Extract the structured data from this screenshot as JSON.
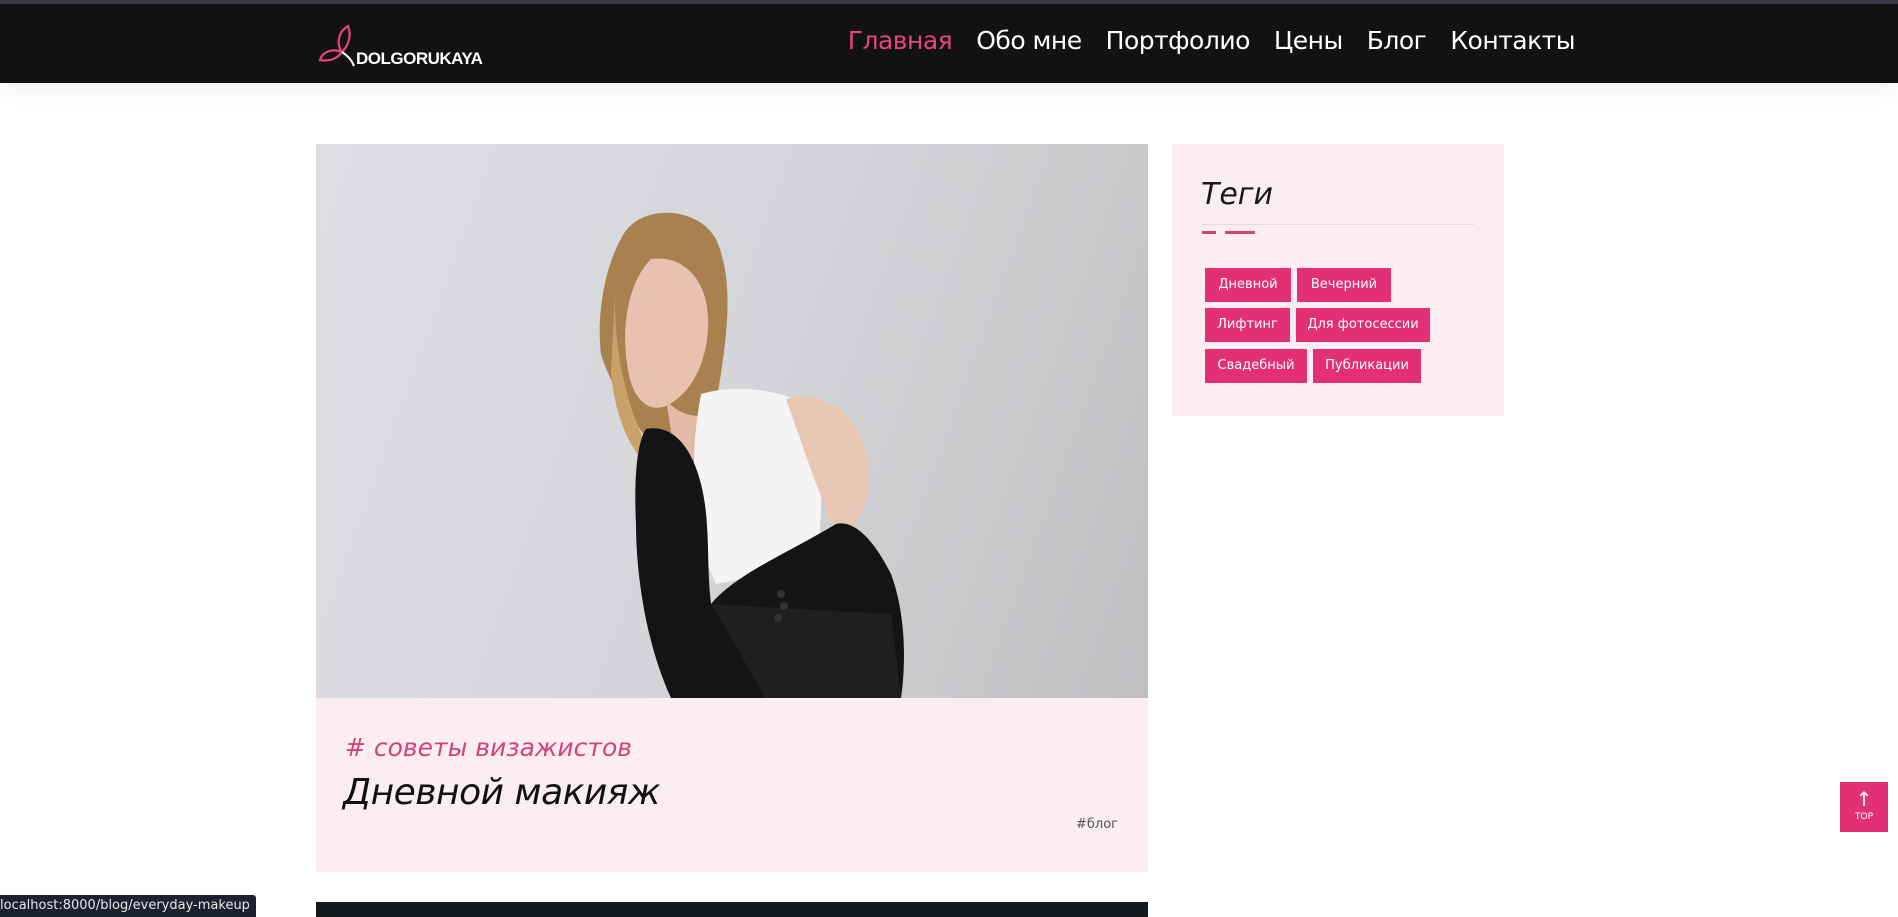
{
  "brand": {
    "logo_text": "DOLGORUKAYA",
    "accent": "#e7457a"
  },
  "nav": {
    "items": [
      "Главная",
      "Обо мне",
      "Портфолио",
      "Цены",
      "Блог",
      "Контакты"
    ],
    "active_index": 0
  },
  "post": {
    "category": "# советы визажистов",
    "title": "Дневной макияж",
    "tag": "#блог"
  },
  "sidebar": {
    "title": "Теги",
    "tags": [
      "Дневной",
      "Вечерний",
      "Лифтинг",
      "Для фотосессии",
      "Свадебный",
      "Публикации"
    ]
  },
  "scroll_top": {
    "label": "TOP"
  },
  "status_bar": {
    "url": "localhost:8000/blog/everyday-makeup"
  }
}
